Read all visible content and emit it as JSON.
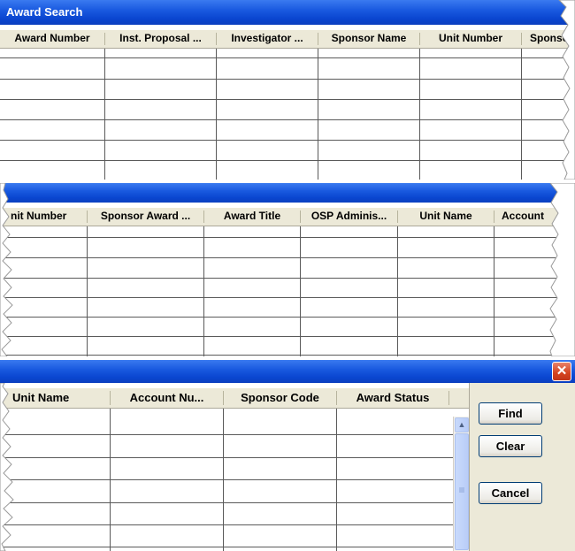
{
  "window": {
    "title": "Award Search",
    "close_glyph": "✕"
  },
  "section1": {
    "columns": [
      "Award Number",
      "Inst. Proposal ...",
      "Investigator ...",
      "Sponsor Name",
      "Unit Number",
      "Sponso"
    ]
  },
  "section2": {
    "columns": [
      "nit Number",
      "Sponsor Award ...",
      "Award Title",
      "OSP Adminis...",
      "Unit Name",
      "Account"
    ]
  },
  "section3": {
    "columns": [
      "Unit Name",
      "Account Nu...",
      "Sponsor Code",
      "Award Status"
    ],
    "buttons": {
      "find": "Find",
      "clear": "Clear",
      "cancel": "Cancel"
    },
    "scroll_up_glyph": "▲"
  },
  "icons": {
    "close": "close-icon",
    "scroll_up": "scroll-up-icon",
    "scroll_thumb_grip": "grip-icon"
  }
}
